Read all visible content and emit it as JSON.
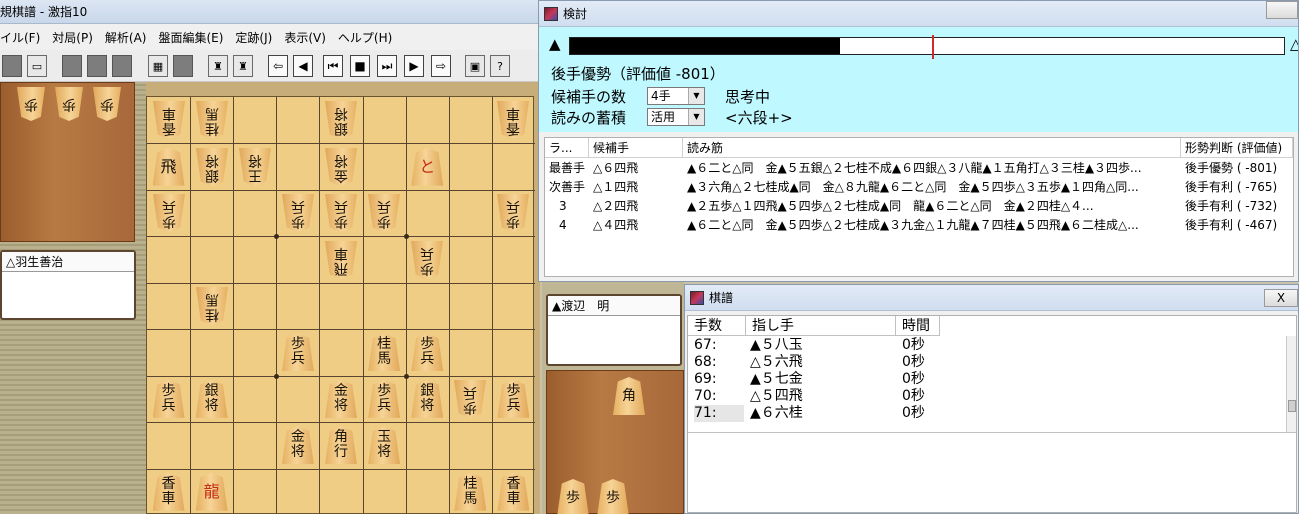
{
  "main_window": {
    "title": "規棋譜 - 激指10",
    "menu": [
      "イル(F)",
      "対局(P)",
      "解析(A)",
      "盤面編集(E)",
      "定跡(J)",
      "表示(V)",
      "ヘルプ(H)"
    ],
    "gote_player": "△羽生善治",
    "sente_player": "▲渡辺　明",
    "gote_hand": [
      "歩",
      "歩",
      "歩"
    ],
    "sente_hand": [
      "角"
    ],
    "sente_hand_bottom": [
      "歩",
      "歩"
    ]
  },
  "board": [
    {
      "r": 1,
      "c": 1,
      "t": "香車",
      "g": true
    },
    {
      "r": 1,
      "c": 2,
      "t": "桂馬",
      "g": true
    },
    {
      "r": 1,
      "c": 5,
      "t": "銀将",
      "g": true
    },
    {
      "r": 1,
      "c": 9,
      "t": "香車",
      "g": true
    },
    {
      "r": 2,
      "c": 1,
      "t": "飛",
      "g": false,
      "red": false,
      "single": true
    },
    {
      "r": 2,
      "c": 2,
      "t": "銀将",
      "g": true
    },
    {
      "r": 2,
      "c": 3,
      "t": "王将",
      "g": true
    },
    {
      "r": 2,
      "c": 5,
      "t": "金将",
      "g": true
    },
    {
      "r": 2,
      "c": 7,
      "t": "と",
      "g": false,
      "red": true,
      "single": true
    },
    {
      "r": 3,
      "c": 1,
      "t": "歩兵",
      "g": true
    },
    {
      "r": 3,
      "c": 4,
      "t": "歩兵",
      "g": true
    },
    {
      "r": 3,
      "c": 5,
      "t": "歩兵",
      "g": true
    },
    {
      "r": 3,
      "c": 6,
      "t": "歩兵",
      "g": true
    },
    {
      "r": 3,
      "c": 9,
      "t": "歩兵",
      "g": true
    },
    {
      "r": 4,
      "c": 5,
      "t": "飛車",
      "g": true
    },
    {
      "r": 4,
      "c": 7,
      "t": "歩兵",
      "g": true
    },
    {
      "r": 5,
      "c": 2,
      "t": "桂馬",
      "g": true
    },
    {
      "r": 6,
      "c": 4,
      "t": "歩兵",
      "g": false
    },
    {
      "r": 6,
      "c": 6,
      "t": "桂馬",
      "g": false
    },
    {
      "r": 6,
      "c": 7,
      "t": "歩兵",
      "g": false
    },
    {
      "r": 7,
      "c": 1,
      "t": "歩兵",
      "g": false
    },
    {
      "r": 7,
      "c": 2,
      "t": "銀将",
      "g": false
    },
    {
      "r": 7,
      "c": 5,
      "t": "金将",
      "g": false
    },
    {
      "r": 7,
      "c": 6,
      "t": "歩兵",
      "g": false
    },
    {
      "r": 7,
      "c": 7,
      "t": "銀将",
      "g": false
    },
    {
      "r": 7,
      "c": 8,
      "t": "歩兵",
      "g": true
    },
    {
      "r": 7,
      "c": 9,
      "t": "歩兵",
      "g": false
    },
    {
      "r": 8,
      "c": 4,
      "t": "金将",
      "g": false
    },
    {
      "r": 8,
      "c": 5,
      "t": "角行",
      "g": false
    },
    {
      "r": 8,
      "c": 6,
      "t": "玉将",
      "g": false
    },
    {
      "r": 9,
      "c": 1,
      "t": "香車",
      "g": false
    },
    {
      "r": 9,
      "c": 2,
      "t": "龍",
      "g": false,
      "red": true,
      "single": true
    },
    {
      "r": 9,
      "c": 8,
      "t": "桂馬",
      "g": false
    },
    {
      "r": 9,
      "c": 9,
      "t": "香車",
      "g": false
    }
  ],
  "kentou": {
    "title": "検討",
    "eval_left_mark": "▲",
    "eval_right_mark": "△",
    "eval_fill_fraction": 0.45,
    "status": "後手優勢（評価値 -801）",
    "candidates_label": "候補手の数",
    "candidates_value": "4手",
    "thinking": "思考中",
    "accumulate_label": "読みの蓄積",
    "accumulate_value": "活用",
    "level": "<六段+>",
    "headers": [
      "ラ...",
      "候補手",
      "読み筋",
      "形勢判断 (評価値)"
    ],
    "rows": [
      [
        "最善手",
        "△６四飛",
        "▲６二と△同　金▲５五銀△２七桂不成▲６四銀△３八龍▲１五角打△３三桂▲３四歩...",
        "後手優勢 ( -801)"
      ],
      [
        "次善手",
        "△１四飛",
        "▲３六角△２七桂成▲同　金△８九龍▲６二と△同　金▲５四歩△３五歩▲１四角△同...",
        "後手有利 ( -765)"
      ],
      [
        "3",
        "△２四飛",
        "▲２五歩△１四飛▲５四歩△２七桂成▲同　龍▲６二と△同　金▲２四桂△４...",
        "後手有利 ( -732)"
      ],
      [
        "4",
        "△４四飛",
        "▲６二と△同　金▲５四歩△２七桂成▲３九金△１九龍▲７四桂▲５四飛▲６二桂成△...",
        "後手有利 ( -467)"
      ]
    ]
  },
  "kifu": {
    "title": "棋譜",
    "close": "X",
    "headers": [
      "手数",
      "指し手",
      "時間"
    ],
    "rows": [
      [
        "67:",
        "▲５八玉",
        "0秒"
      ],
      [
        "68:",
        "△５六飛",
        "0秒"
      ],
      [
        "69:",
        "▲５七金",
        "0秒"
      ],
      [
        "70:",
        "△５四飛",
        "0秒"
      ],
      [
        "71:",
        "▲６六桂",
        "0秒"
      ]
    ]
  }
}
